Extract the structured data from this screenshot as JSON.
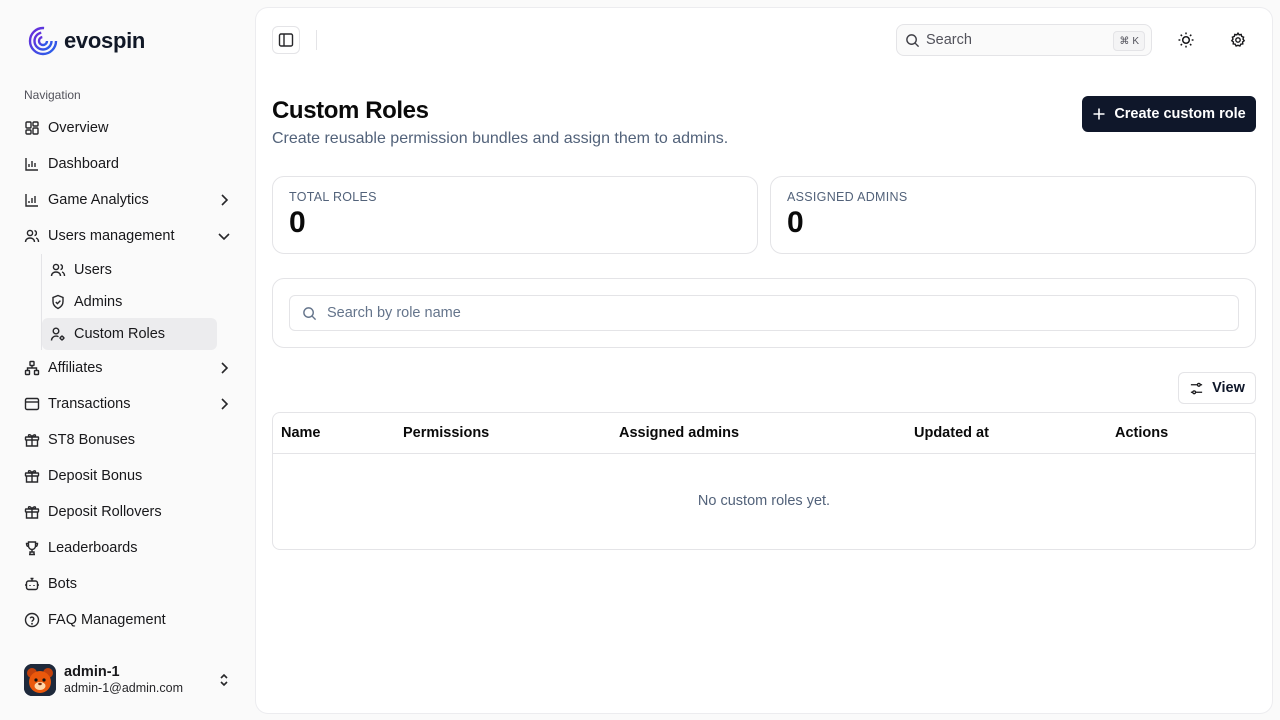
{
  "brand": {
    "name": "evospin"
  },
  "sidebar": {
    "heading": "Navigation",
    "items": [
      {
        "label": "Overview",
        "icon": "grid-icon"
      },
      {
        "label": "Dashboard",
        "icon": "bar-chart-icon"
      },
      {
        "label": "Game Analytics",
        "icon": "analytics-icon",
        "chevron": "right"
      },
      {
        "label": "Users management",
        "icon": "users-icon",
        "chevron": "down"
      },
      {
        "label": "Affiliates",
        "icon": "network-icon",
        "chevron": "right"
      },
      {
        "label": "Transactions",
        "icon": "wallet-icon",
        "chevron": "right"
      },
      {
        "label": "ST8 Bonuses",
        "icon": "gift-icon"
      },
      {
        "label": "Deposit Bonus",
        "icon": "gift-icon"
      },
      {
        "label": "Deposit Rollovers",
        "icon": "gift-icon"
      },
      {
        "label": "Leaderboards",
        "icon": "trophy-icon"
      },
      {
        "label": "Bots",
        "icon": "bot-icon"
      },
      {
        "label": "FAQ Management",
        "icon": "help-circle-icon"
      }
    ],
    "subitems": [
      {
        "label": "Users",
        "icon": "users-icon"
      },
      {
        "label": "Admins",
        "icon": "shield-icon"
      },
      {
        "label": "Custom Roles",
        "icon": "user-cog-icon",
        "active": true
      }
    ]
  },
  "user": {
    "name": "admin-1",
    "email": "admin-1@admin.com"
  },
  "topbar": {
    "search_placeholder": "Search",
    "shortcut_symbol": "⌘",
    "shortcut_key": "K"
  },
  "page": {
    "title": "Custom Roles",
    "subtitle": "Create reusable permission bundles and assign them to admins.",
    "create_label": "Create custom role"
  },
  "stats": [
    {
      "label": "TOTAL ROLES",
      "value": "0"
    },
    {
      "label": "ASSIGNED ADMINS",
      "value": "0"
    }
  ],
  "filter": {
    "placeholder": "Search by role name"
  },
  "view_label": "View",
  "table": {
    "columns": [
      "Name",
      "Permissions",
      "Assigned admins",
      "Updated at",
      "Actions"
    ],
    "empty_text": "No custom roles yet."
  },
  "colors": {
    "primary": "#0f172a",
    "active_bg": "#ececee",
    "brand": "#4f46e5"
  }
}
